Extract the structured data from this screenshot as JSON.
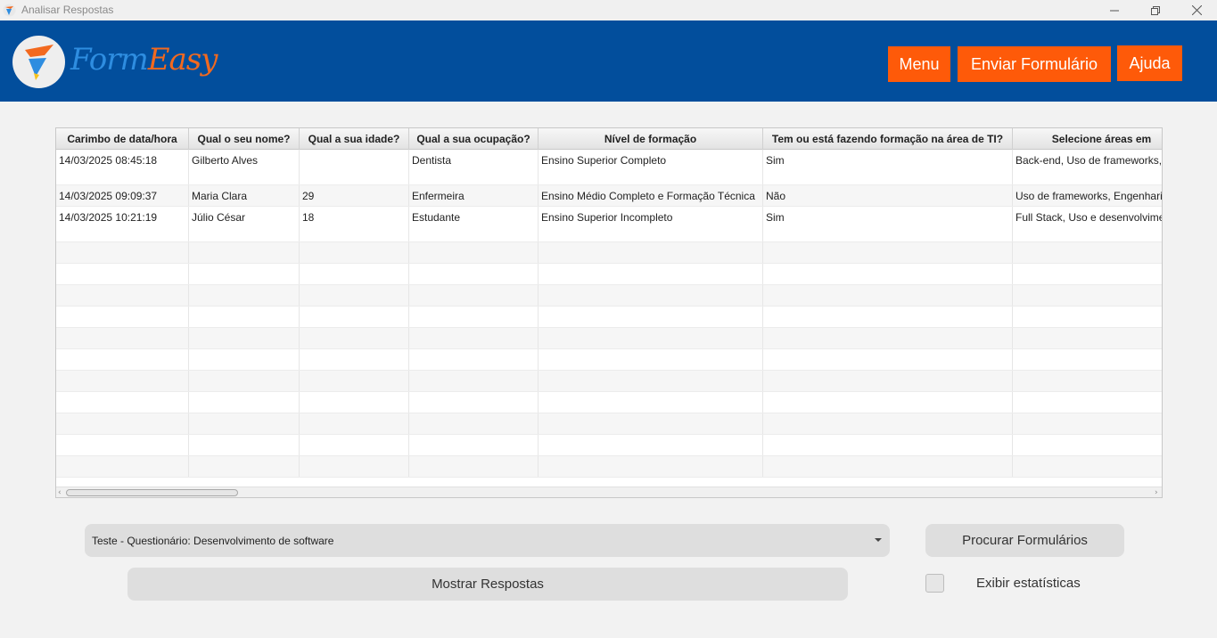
{
  "window": {
    "title": "Analisar Respostas",
    "controls": {
      "minimize": "—",
      "maximize": "❐",
      "close": "✕"
    }
  },
  "header": {
    "logo_part1": "Form",
    "logo_part2": "Easy",
    "buttons": {
      "menu": "Menu",
      "send": "Enviar Formulário",
      "help": "Ajuda"
    },
    "colors": {
      "header_bg": "#024e9c",
      "button_bg": "#fe5a09"
    }
  },
  "table": {
    "columns": [
      "Carimbo de data/hora",
      "Qual o seu nome?",
      "Qual a sua idade?",
      "Qual a sua ocupação?",
      "Nível de formação",
      "Tem ou está fazendo formação na área de TI?",
      "Selecione áreas em"
    ],
    "rows": [
      [
        "14/03/2025 08:45:18",
        "Gilberto Alves",
        "",
        "Dentista",
        "Ensino Superior Completo",
        "Sim",
        "Back-end, Uso de frameworks,"
      ],
      [
        "14/03/2025 09:09:37",
        "Maria Clara",
        "29",
        "Enfermeira",
        "Ensino Médio Completo e Formação Técnica",
        "Não",
        "Uso de frameworks, Engenharia"
      ],
      [
        "14/03/2025 10:21:19",
        "Júlio César",
        "18",
        "Estudante",
        "Ensino Superior Incompleto",
        "Sim",
        "Full Stack, Uso e desenvolvimen"
      ]
    ]
  },
  "controls": {
    "form_select": "Teste - Questionário: Desenvolvimento de software",
    "search_button": "Procurar Formulários",
    "show_button": "Mostrar Respostas",
    "stats_checkbox_label": "Exibir estatísticas",
    "stats_checked": false
  }
}
